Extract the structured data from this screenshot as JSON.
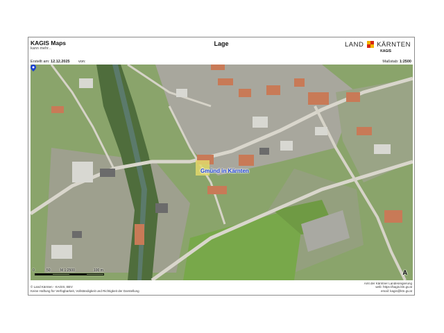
{
  "header": {
    "app_title": "KAGIS Maps",
    "app_subtitle": "kann mehr...",
    "page_title": "Lage",
    "logo_left": "LAND",
    "logo_right": "KÄRNTEN",
    "logo_sub": "KAGIS"
  },
  "meta": {
    "created_label": "Erstellt am:",
    "created_date": "12.12.2025",
    "by_label": "von:",
    "scale_label": "Maßstab:",
    "scale_value": "1:2500"
  },
  "map": {
    "place_label": "Gmünd in Kärnten",
    "pin_icon": "location-pin-icon",
    "north_arrow": "A",
    "scale_labels": [
      "0",
      "50",
      "M 1:2500",
      "100 m"
    ]
  },
  "footer": {
    "left_line1": "© Land Kärnten - KAGIS, BEV",
    "left_line2": "Keine Haftung für Verfügbarkeit, Vollständigkeit und Richtigkeit der Darstellung",
    "right_line1": "Amt der Kärntner Landesregierung",
    "right_line2": "web: https://kagis.ktn.gv.at",
    "right_line3": "email: kagis@ktn.gv.at"
  },
  "colors": {
    "label_blue": "#1a3fd0",
    "logo_yellow": "#f2b300",
    "logo_red": "#d62612"
  }
}
